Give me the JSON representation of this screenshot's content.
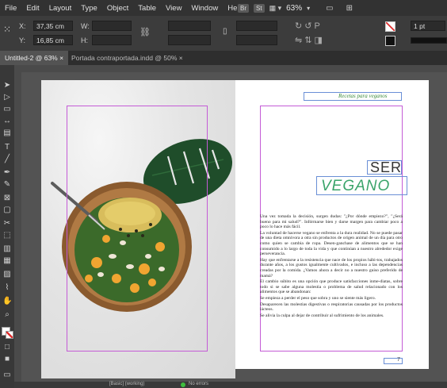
{
  "menubar": {
    "items": [
      "File",
      "Edit",
      "Layout",
      "Type",
      "Object",
      "Table",
      "View",
      "Window",
      "Help"
    ],
    "badges": [
      "Br",
      "St"
    ],
    "zoom": "63%"
  },
  "control_panel": {
    "x_label": "X:",
    "x_value": "37,35 cm",
    "y_label": "Y:",
    "y_value": "16,85 cm",
    "w_label": "W:",
    "h_label": "H:",
    "stroke_weight": "1 pt"
  },
  "tabs": [
    {
      "label": "Untitled-2 @ 63% ×"
    },
    {
      "label": "Portada contraportada.indd @ 50% ×"
    }
  ],
  "status_bar": {
    "preflight_profile": "[Basic] (working)",
    "errors": "No errors"
  },
  "document": {
    "header": "Recetas para veganos",
    "title_line1": "SER",
    "title_line2": "VEGANO",
    "page_number": "7",
    "paragraphs": [
      "Una vez tomada la decisión, surgen dudas: \"¿Por dónde empiezo?\", \"¿Será bueno para mi salud?\". Infórmarse bien y darse margen para cambiar poco a poco lo hace más fácil.",
      "La voluntad de hacerse vegano se enfrenta a la dura realidad. No se puede pasar de una dieta omnívora a otra sin productos de origen animal de un día para otro como quien se cambia de ropa. Desen-ganchase de alimentos que se han consumido a lo largo de toda la vida y que continúan a nuestro alrededor exige perseverancia.",
      "Hay que enfrentarse a la resistencia que nace de los propios hábi-tos, trabajados durante años, a los gustos igualmente cultivados, e incluso a las dependencias creadas por la comida. ¿Vamos ahora a decir no a nuestro guiso preferido de mamá?",
      "El cambio súbito es una opción que produce satisfacciones inme-diatas, sobre todo si se sabe alguna molestia o problema de salud relacionado con los alimentos que se abandonan:",
      "Se empieza a perder el peso que sobra y uno se siente más ligero.",
      "Desaparecen las molestias digestivas o respiratorias causadas por los productos lácteos.",
      "Se alivia la culpa al dejar de contribuir al sufrimiento de los animales."
    ]
  },
  "colors": {
    "margin_guide": "#c45bd6",
    "frame_edge": "#6a8fd6",
    "title_green": "#3aa46a",
    "header_green": "#3a8a3a"
  }
}
